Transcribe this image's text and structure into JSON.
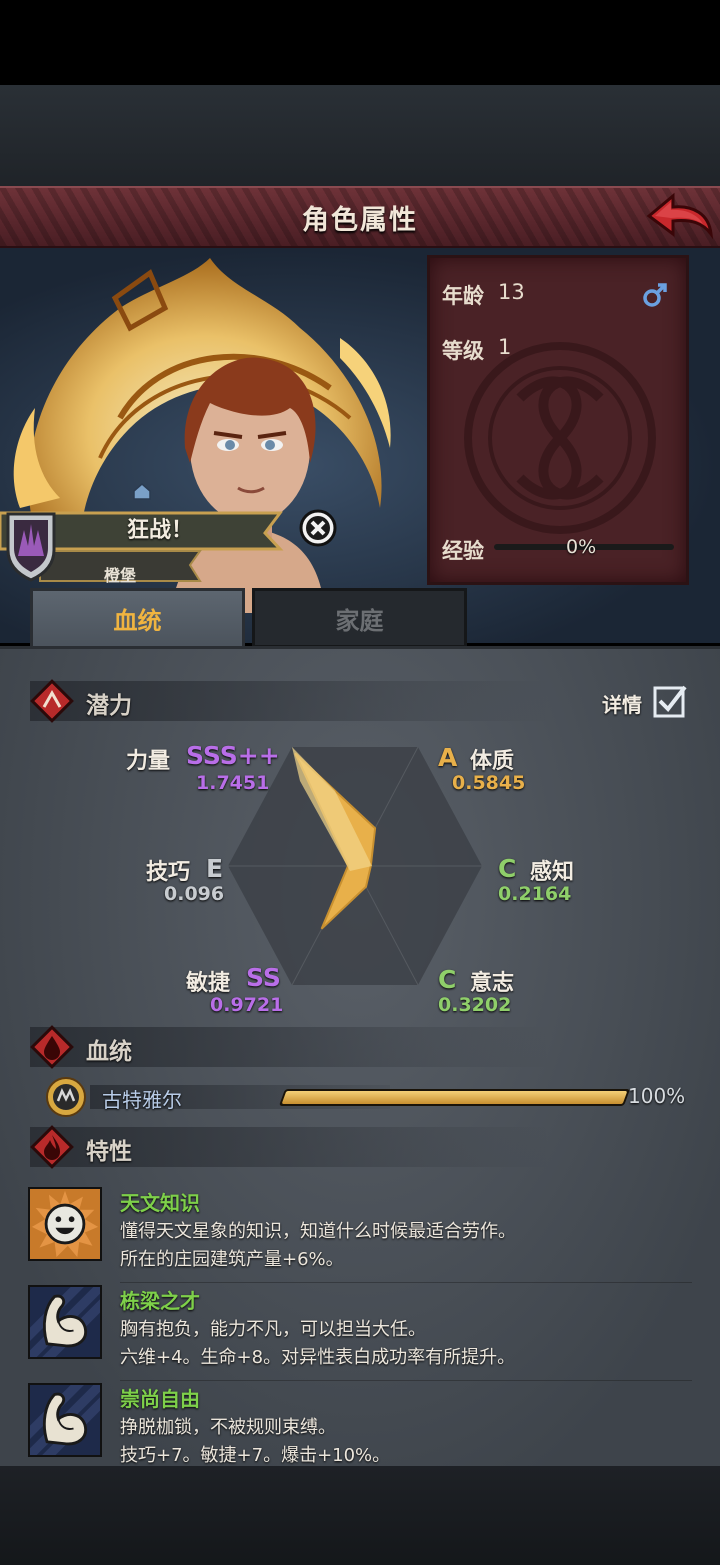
{
  "header": {
    "title": "角色属性"
  },
  "character": {
    "age_label": "年龄",
    "age": "13",
    "gender_icon": "male-icon",
    "level_label": "等级",
    "level": "1",
    "exp_label": "经验",
    "exp_percent_text": "0%",
    "exp_progress": 0,
    "title_text": "狂战！",
    "family_name": "橙堡"
  },
  "tabs": [
    {
      "label": "血统",
      "active": true
    },
    {
      "label": "家庭",
      "active": false
    }
  ],
  "potential": {
    "section_title": "潜力",
    "details_label": "详情",
    "details_checked": true,
    "stats": [
      {
        "name": "力量",
        "grade": "SSS++",
        "value": "1.7451",
        "value_num": 1.7451
      },
      {
        "name": "体质",
        "grade": "A",
        "value": "0.5845",
        "value_num": 0.5845
      },
      {
        "name": "感知",
        "grade": "C",
        "value": "0.2164",
        "value_num": 0.2164
      },
      {
        "name": "意志",
        "grade": "C",
        "value": "0.3202",
        "value_num": 0.3202
      },
      {
        "name": "敏捷",
        "grade": "SS",
        "value": "0.9721",
        "value_num": 0.9721
      },
      {
        "name": "技巧",
        "grade": "E",
        "value": "0.096",
        "value_num": 0.096
      }
    ]
  },
  "bloodline": {
    "section_title": "血统",
    "name": "古特雅尔",
    "percent_text": "100%",
    "progress": 1.0
  },
  "traits": {
    "section_title": "特性",
    "items": [
      {
        "name": "天文知识",
        "line1": "懂得天文星象的知识，知道什么时候最适合劳作。",
        "line2": "所在的庄园建筑产量+6%。",
        "icon": "smiley-sun-icon"
      },
      {
        "name": "栋梁之才",
        "line1": "胸有抱负，能力不凡，可以担当大任。",
        "line2": "六维+4。生命+8。对异性表白成功率有所提升。",
        "icon": "flexed-arm-icon"
      },
      {
        "name": "崇尚自由",
        "line1": "挣脱枷锁，不被规则束缚。",
        "line2": "技巧+7。敏捷+7。爆击+10%。",
        "icon": "flexed-arm-icon"
      }
    ]
  },
  "colors": {
    "accent_gold": "#e8b04a",
    "grade_purple": "#b96ee8",
    "grade_green": "#8fcf6a",
    "trait_green": "#7ed04a",
    "title_bar": "#5e2a30"
  }
}
